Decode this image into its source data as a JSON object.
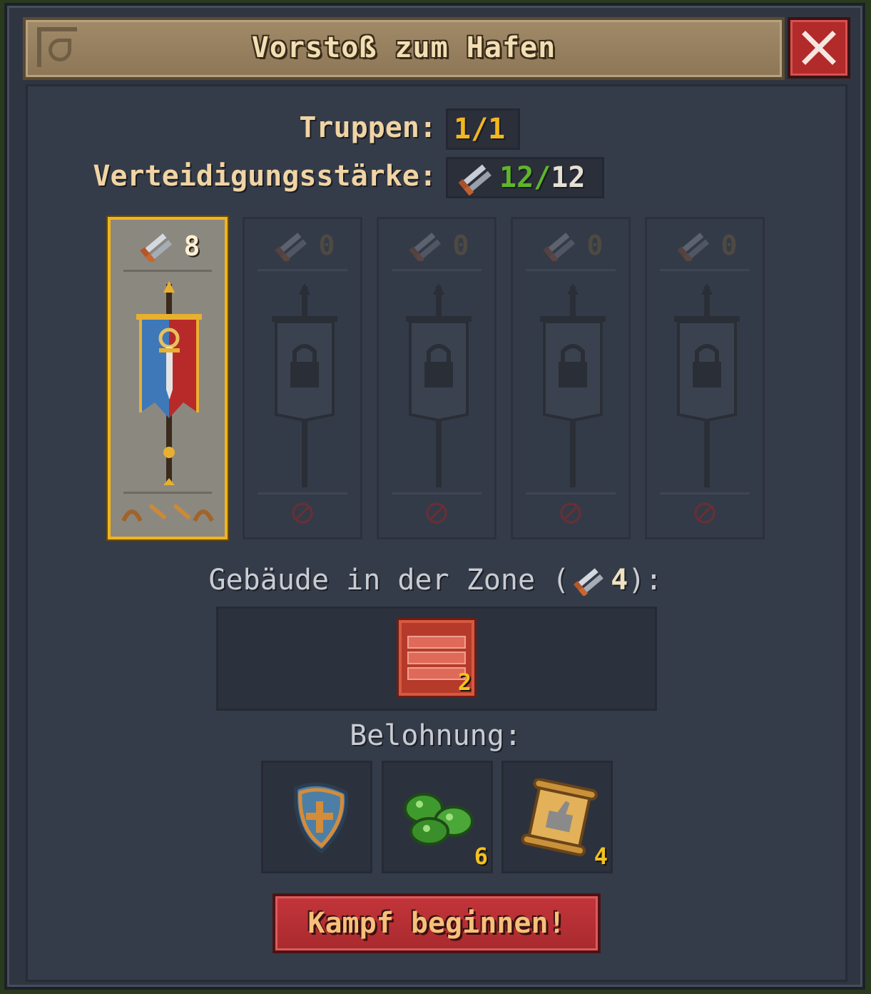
{
  "dialog": {
    "title": "Vorstoß zum Hafen",
    "close_label": "close"
  },
  "stats": {
    "troops_label": "Truppen:",
    "troops_value": "1/1",
    "defense_label": "Verteidigungsstärke:",
    "defense_current": "12",
    "defense_separator": "/",
    "defense_max": "12"
  },
  "slots": [
    {
      "power": "8",
      "state": "filled",
      "banner": "knight-banner"
    },
    {
      "power": "0",
      "state": "locked"
    },
    {
      "power": "0",
      "state": "locked"
    },
    {
      "power": "0",
      "state": "locked"
    },
    {
      "power": "0",
      "state": "locked"
    }
  ],
  "zone": {
    "label_prefix": "Gebäude in der Zone (",
    "label_value": "4",
    "label_suffix": "):",
    "building_count": "2"
  },
  "rewards": {
    "label": "Belohnung:",
    "items": [
      {
        "icon": "shield-icon",
        "count": ""
      },
      {
        "icon": "slime-icon",
        "count": "6"
      },
      {
        "icon": "scroll-icon",
        "count": "4"
      }
    ]
  },
  "actions": {
    "fight_label": "Kampf beginnen!"
  },
  "colors": {
    "accent_gold": "#f0b51c",
    "close_red": "#b22a2a",
    "power_green": "#5fb52a"
  }
}
